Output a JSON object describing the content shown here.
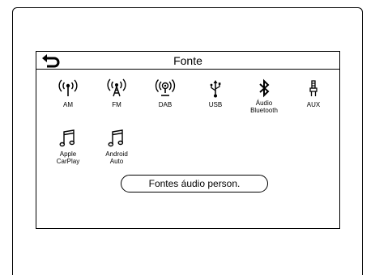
{
  "screen": {
    "title": "Fonte",
    "back_icon": "back-arrow-icon"
  },
  "sources": [
    {
      "id": "am",
      "label": "AM",
      "icon": "radio-antenna-icon"
    },
    {
      "id": "fm",
      "label": "FM",
      "icon": "tower-antenna-icon"
    },
    {
      "id": "dab",
      "label": "DAB",
      "icon": "digital-radio-icon"
    },
    {
      "id": "usb",
      "label": "USB",
      "icon": "usb-icon"
    },
    {
      "id": "bt",
      "label": "Áudio\nBluetooth",
      "icon": "bluetooth-icon"
    },
    {
      "id": "aux",
      "label": "AUX",
      "icon": "aux-jack-icon"
    },
    {
      "id": "carplay",
      "label": "Apple\nCarPlay",
      "icon": "music-note-icon"
    },
    {
      "id": "androidauto",
      "label": "Android\nAuto",
      "icon": "music-note-icon"
    }
  ],
  "custom_button": {
    "label": "Fontes áudio person."
  }
}
